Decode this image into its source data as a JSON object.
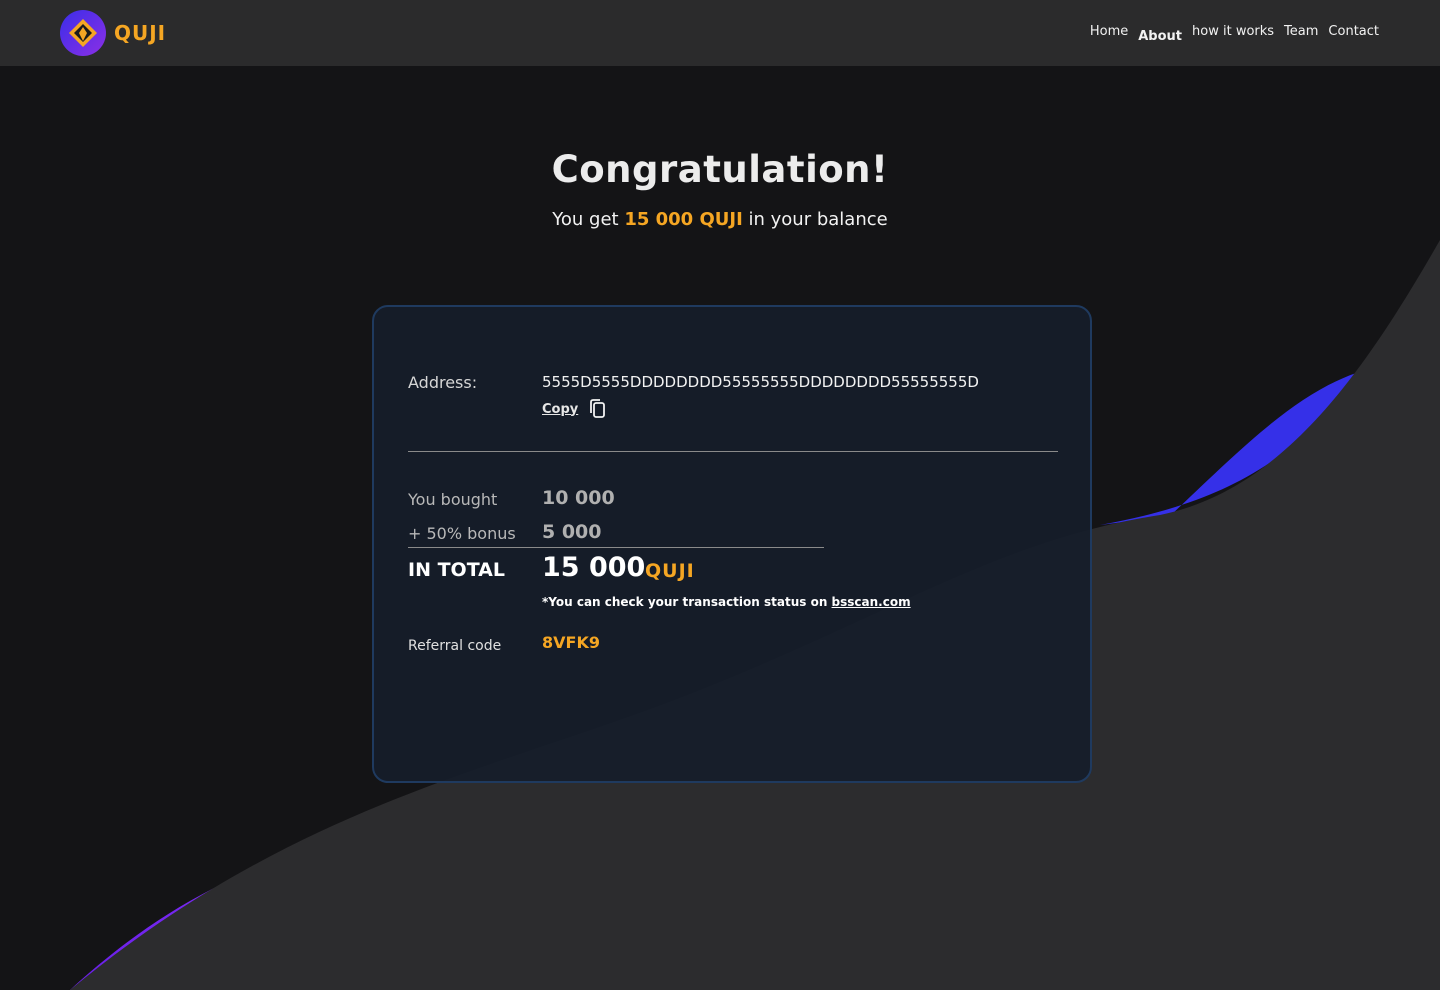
{
  "header": {
    "logo_text": "QUJI",
    "nav": [
      {
        "label": "Home"
      },
      {
        "label": "About",
        "active": true
      },
      {
        "label": "how it works"
      },
      {
        "label": "Team"
      },
      {
        "label": "Contact"
      }
    ]
  },
  "hero": {
    "title": "Congratulation!",
    "subtitle_prefix": "You get ",
    "subtitle_highlight": "15 000 QUJI",
    "subtitle_suffix": " in your balance"
  },
  "card": {
    "address_label": "Address:",
    "address_value": "5555D5555DDDDDDDD55555555DDDDDDDD55555555D",
    "copy_label": "Copy",
    "copy_icon": "copy-icon",
    "bought_label": "You bought",
    "bought_value": "10 000",
    "bonus_label": "+ 50% bonus",
    "bonus_value": "5 000",
    "total_label": "IN TOTAL",
    "total_value": "15 000",
    "total_unit": "QUJI",
    "note_prefix": "*You can check your transaction status on ",
    "note_link": "bsscan.com",
    "referral_label": "Referral code",
    "referral_value": "8VFK9"
  },
  "colors": {
    "accent": "#f5a623",
    "header_bg": "#2b2b2c",
    "page_bg": "#141416",
    "card_border": "#1f3a5f",
    "wave_blue": "#3530e8",
    "wave_purple": "#7b2cf5"
  }
}
